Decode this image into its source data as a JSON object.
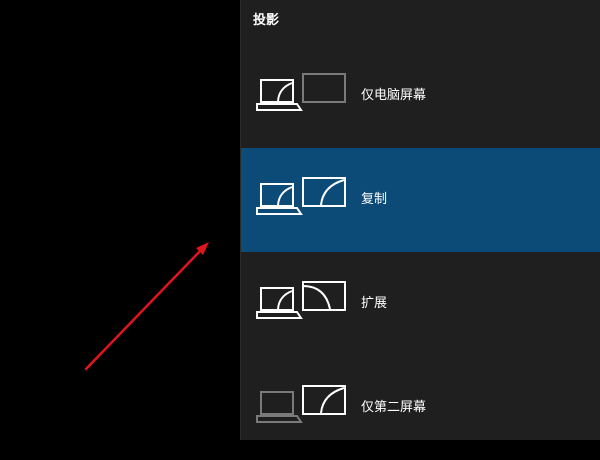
{
  "panel": {
    "title": "投影",
    "options": [
      {
        "label": "仅电脑屏幕",
        "selected": false,
        "icon": "pc-screen-only-icon"
      },
      {
        "label": "复制",
        "selected": true,
        "icon": "duplicate-icon"
      },
      {
        "label": "扩展",
        "selected": false,
        "icon": "extend-icon"
      },
      {
        "label": "仅第二屏幕",
        "selected": false,
        "icon": "second-screen-only-icon"
      }
    ]
  },
  "colors": {
    "panel_bg": "#1f1f1f",
    "selected_bg": "#0c4a78",
    "icon_active": "#ffffff",
    "icon_dim": "#7a7a7a",
    "arrow": "#e0141e"
  }
}
